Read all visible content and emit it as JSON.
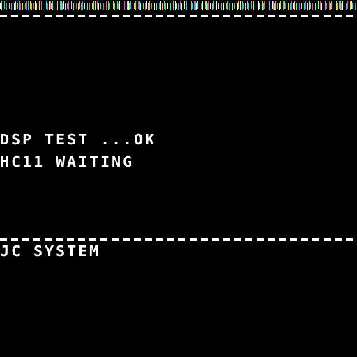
{
  "screen": {
    "background": "#000000",
    "text_color": "#ffffff",
    "garbage_colors": [
      "#ffffff",
      "#00e0ff",
      "#ffe000",
      "#ff40c0",
      "#40ff60"
    ]
  },
  "status": {
    "dsp_test": "DSP TEST ...OK",
    "hc11": "HC11 WAITING"
  },
  "footer": {
    "system_name": "JC SYSTEM"
  }
}
